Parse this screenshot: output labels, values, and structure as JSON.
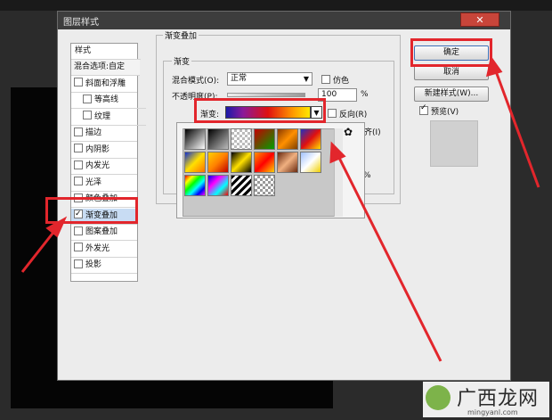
{
  "dialog": {
    "title": "图层样式",
    "close_symbol": "✕"
  },
  "styles_panel": {
    "header": "样式",
    "items": [
      {
        "label": "混合选项:自定",
        "checkbox": false,
        "indent": false,
        "selected": false
      },
      {
        "label": "斜面和浮雕",
        "checkbox": true,
        "checked": false,
        "indent": false
      },
      {
        "label": "等高线",
        "checkbox": true,
        "checked": false,
        "indent": true
      },
      {
        "label": "纹理",
        "checkbox": true,
        "checked": false,
        "indent": true
      },
      {
        "label": "描边",
        "checkbox": true,
        "checked": false,
        "indent": false
      },
      {
        "label": "内阴影",
        "checkbox": true,
        "checked": false,
        "indent": false
      },
      {
        "label": "内发光",
        "checkbox": true,
        "checked": false,
        "indent": false
      },
      {
        "label": "光泽",
        "checkbox": true,
        "checked": false,
        "indent": false
      },
      {
        "label": "颜色叠加",
        "checkbox": true,
        "checked": false,
        "indent": false
      },
      {
        "label": "渐变叠加",
        "checkbox": true,
        "checked": true,
        "indent": false,
        "selected": true
      },
      {
        "label": "图案叠加",
        "checkbox": true,
        "checked": false,
        "indent": false
      },
      {
        "label": "外发光",
        "checkbox": true,
        "checked": false,
        "indent": false
      },
      {
        "label": "投影",
        "checkbox": true,
        "checked": false,
        "indent": false
      }
    ]
  },
  "gradient_overlay": {
    "group_label": "渐变叠加",
    "sub_group_label": "渐变",
    "blend_mode_label": "混合模式(O):",
    "blend_mode_value": "正常",
    "dither_label": "仿色",
    "opacity_label": "不透明度(P):",
    "opacity_value": "100",
    "opacity_unit": "%",
    "gradient_label": "渐变:",
    "reverse_label": "反向(R)",
    "align_label": "齐(I)",
    "percent_unit": "%"
  },
  "right_panel": {
    "ok_label": "确定",
    "cancel_label": "取消",
    "new_style_label": "新建样式(W)...",
    "preview_label": "预览(V)",
    "preview_checked": true
  },
  "watermark": {
    "text": "广西龙网",
    "sub": "mingyanl.com"
  },
  "colors": {
    "highlight_red": "#e2262c",
    "dialog_bg": "#ececec",
    "selected_row": "#c8dcf3"
  }
}
